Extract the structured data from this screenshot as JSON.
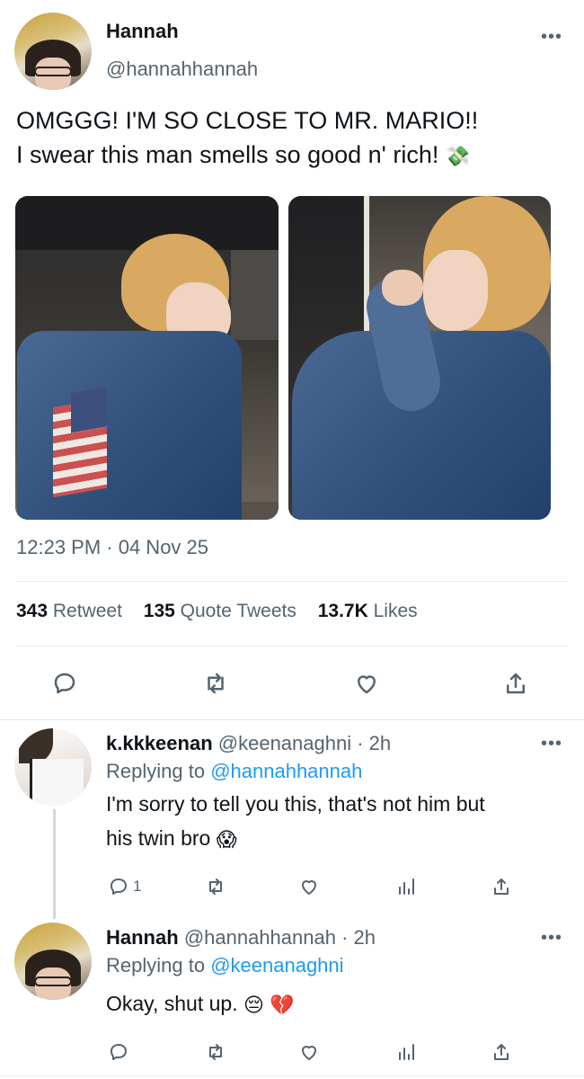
{
  "tweet": {
    "author": {
      "name": "Hannah",
      "handle": "@hannahhannah"
    },
    "text_line1": "OMGGG! I'M SO CLOSE TO MR. MARIO!!",
    "text_line2": "I swear this man smells so good n' rich!",
    "text_emoji": "💸",
    "timestamp": "12:23 PM · 04 Nov 25",
    "stats": {
      "retweets": "343",
      "retweets_label": "Retweet",
      "quotes": "135",
      "quotes_label": "Quote Tweets",
      "likes": "13.7K",
      "likes_label": "Likes"
    },
    "more_glyph": "•••"
  },
  "replies": [
    {
      "name": "k.kkkeenan",
      "handle": "@keenanaghni",
      "time": "· 2h",
      "replying_prefix": "Replying to",
      "replying_to": "@hannahhannah",
      "text_line1": "I'm sorry to tell you this, that's not him but",
      "text_line2": "his twin bro",
      "emoji": "😱",
      "reply_count": "1"
    },
    {
      "name": "Hannah",
      "handle": "@hannahhannah",
      "time": "· 2h",
      "replying_prefix": "Replying to",
      "replying_to": "@keenanaghni",
      "text": "Okay, shut up.",
      "emoji": "😔 💔"
    }
  ],
  "icons": [
    "reply-icon",
    "retweet-icon",
    "like-icon",
    "share-icon",
    "analytics-icon",
    "more-icon"
  ],
  "colors": {
    "text": "#0f1419",
    "secondary": "#536471",
    "link": "#1d9bf0",
    "divider": "#e6e9ec"
  }
}
